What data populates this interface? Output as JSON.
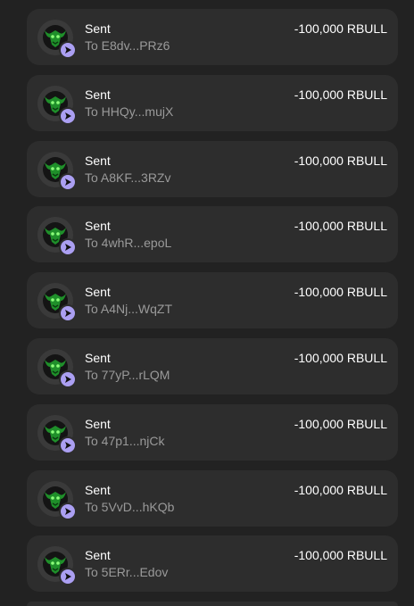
{
  "activity": {
    "transactions": [
      {
        "type": "Sent",
        "counterparty": "To E8dv...PRz6",
        "amount": "-100,000 RBULL"
      },
      {
        "type": "Sent",
        "counterparty": "To HHQy...mujX",
        "amount": "-100,000 RBULL"
      },
      {
        "type": "Sent",
        "counterparty": "To A8KF...3RZv",
        "amount": "-100,000 RBULL"
      },
      {
        "type": "Sent",
        "counterparty": "To 4whR...epoL",
        "amount": "-100,000 RBULL"
      },
      {
        "type": "Sent",
        "counterparty": "To A4Nj...WqZT",
        "amount": "-100,000 RBULL"
      },
      {
        "type": "Sent",
        "counterparty": "To 77yP...rLQM",
        "amount": "-100,000 RBULL"
      },
      {
        "type": "Sent",
        "counterparty": "To 47p1...njCk",
        "amount": "-100,000 RBULL"
      },
      {
        "type": "Sent",
        "counterparty": "To 5VvD...hKQb",
        "amount": "-100,000 RBULL"
      },
      {
        "type": "Sent",
        "counterparty": "To 5ERr...Edov",
        "amount": "-100,000 RBULL"
      }
    ]
  },
  "colors": {
    "background": "#222222",
    "card": "#2d2d2d",
    "badge": "#ab9ff2",
    "primary_text": "#ffffff",
    "secondary_text": "#9a9a9a",
    "token_glow": "#2ecc40"
  },
  "icons": {
    "token": "rbull-token-icon",
    "badge": "sent-arrow-icon"
  }
}
